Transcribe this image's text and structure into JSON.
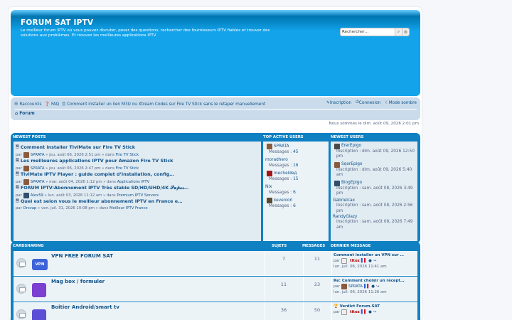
{
  "header": {
    "title": "FORUM SAT IPTV",
    "description": "Le meilleur forum IPTV où vous pouvez discuter, poser des questions, rechercher des fournisseurs IPTV fiables et trouver des solutions aux problèmes. Et trouvez les meilleures applications IPTV",
    "search_placeholder": "Rechercher…"
  },
  "nav": {
    "left": [
      {
        "label": "Raccourcis",
        "icon": "bars-icon"
      },
      {
        "label": "FAQ",
        "icon": "question-icon"
      },
      {
        "label": "Comment installer un lien M3U ou Xtream Codes sur Fire TV Stick sans le retaper manuellement",
        "icon": "document-icon"
      }
    ],
    "right": [
      {
        "label": "Inscription",
        "icon": "pencil-icon"
      },
      {
        "label": "Connexion",
        "icon": "power-icon"
      },
      {
        "label": "Mode sombre",
        "icon": "moon-icon"
      }
    ],
    "breadcrumb": "Forum"
  },
  "timeline": "Nous sommes le dim. août 09, 2026 2:01 pm",
  "stats_panel": {
    "headers": {
      "newest_posts": "NEWEST POSTS",
      "top_users": "TOP ACTIVE USERS",
      "newest_users": "NEWEST USERS"
    },
    "posts": [
      {
        "title": "Comment installer TiviMate sur Fire TV Stick",
        "by": "par",
        "user": "SPRATA",
        "date": "» jeu. août 06, 2026 2:51 pm » dans",
        "forum": "Fire TV Stick"
      },
      {
        "title": "Les meilleures applications IPTV pour Amazon Fire TV Stick",
        "by": "par",
        "user": "SPRATA",
        "date": "» jeu. août 06, 2026 2:47 pm » dans",
        "forum": "Fire TV Stick"
      },
      {
        "title": "TiviMate IPTV Player : guide complet d’installation, config…",
        "by": "par",
        "user": "SPRATA",
        "date": "» mar. août 04, 2026 1:12 pm » dans",
        "forum": "Applications IPTV"
      },
      {
        "title": "FORUM IPTV:Abonnement IPTV Très stable SD/HD/UHD/4K 𝓢𝓾𝓹𝓮𝓻…",
        "by": "par",
        "user": "Alex59",
        "date": "» lun. août 03, 2026 11:12 am » dans",
        "forum": "Premium IPTV Servers"
      },
      {
        "title": "Quel est selon vous le meilleur abonnement IPTV en France e…",
        "by": "par",
        "user": "Orsvap",
        "date": "» ven. juil. 31, 2026 10:08 pm » dans",
        "forum": "Meilleur IPTV France"
      }
    ],
    "top_users": [
      {
        "name": "SPRATA",
        "label": "Messages :",
        "count": "45"
      },
      {
        "name": "moradhero",
        "label": "Messages :",
        "count": "16"
      },
      {
        "name": "mecheldeд",
        "label": "Messages :",
        "count": "15"
      },
      {
        "name": "Nix",
        "label": "Messages :",
        "count": "6"
      },
      {
        "name": "kevenlori",
        "label": "Messages :",
        "count": "6"
      }
    ],
    "newest_users": [
      {
        "name": "ErerEpigo",
        "text": "Inscription : dim. août 09, 2026 12:50 pm"
      },
      {
        "name": "SqorEpigo",
        "text": "Inscription : dim. août 09, 2026 5:40 am"
      },
      {
        "name": "BiogEpigo",
        "text": "Inscription : sam. août 08, 2026 3:49 pm"
      },
      {
        "name": "Gabrielcax",
        "text": "Inscription : sam. août 08, 2026 2:56 pm"
      },
      {
        "name": "RandyGlazy",
        "text": "Inscription : sam. août 08, 2026 7:49 am"
      }
    ]
  },
  "forums": {
    "headers": {
      "category": "CARDSHARING",
      "topics": "SUJETS",
      "posts": "MESSAGES",
      "last_post": "DERNIER MESSAGE"
    },
    "rows": [
      {
        "name": "VPN FREE FORUM SAT",
        "logo": "VPN",
        "logo_color": "#3d63d8",
        "topics": "7",
        "posts": "11",
        "last_title": "Comment installer un VPN sur …",
        "by": "par",
        "user": "titoz",
        "date": "lun. juil. 06, 2026 11:41 am"
      },
      {
        "name": "Mag box / formuler",
        "logo": "",
        "logo_color": "#7b3fd1",
        "topics": "11",
        "posts": "23",
        "last_title": "Re: Comment choisir un récept…",
        "by": "par",
        "user": "SPRATA",
        "date": "lun. juil. 06, 2026 11:26 am"
      },
      {
        "name": "Boitier Android/smart tv",
        "logo": "",
        "logo_color": "#5b4fd6",
        "topics": "36",
        "posts": "50",
        "last_title": "Verdict Forum-SAT",
        "by": "par",
        "user": "titoz",
        "date": ""
      }
    ]
  }
}
